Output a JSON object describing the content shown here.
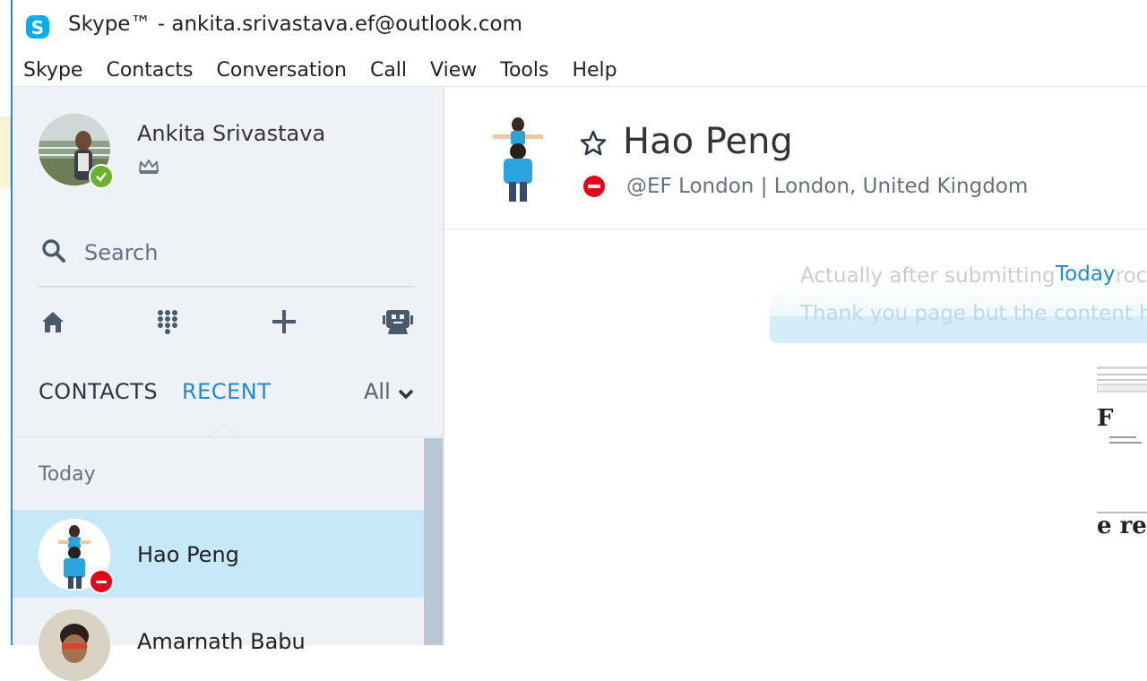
{
  "window": {
    "title": "Skype™ - ankita.srivastava.ef@outlook.com"
  },
  "menu": [
    "Skype",
    "Contacts",
    "Conversation",
    "Call",
    "View",
    "Tools",
    "Help"
  ],
  "profile": {
    "name": "Ankita Srivastava",
    "status": "online"
  },
  "search": {
    "placeholder": "Search"
  },
  "toolbar": [
    "home-icon",
    "dialpad-icon",
    "add-icon",
    "bot-icon"
  ],
  "tabs": {
    "contacts": "CONTACTS",
    "recent": "RECENT",
    "filter": "All"
  },
  "recent": {
    "group": "Today",
    "items": [
      {
        "name": "Hao Peng",
        "status": "do-not-disturb",
        "selected": true
      },
      {
        "name": "Amarnath Babu",
        "status": "unknown",
        "selected": false
      }
    ]
  },
  "conversation": {
    "contact_name": "Hao Peng",
    "contact_info": "@EF London  |  London, United Kingdom",
    "date_label": "Today",
    "message_line1": "Actually after submitting the proc",
    "message_line2": "Thank you page but the content h",
    "thumb_text": "F",
    "thumb_text2": "e re"
  },
  "colors": {
    "accent": "#1d8ad1",
    "selected_row": "#c6e8f8",
    "online": "#67b32e",
    "dnd": "#e2061b"
  }
}
